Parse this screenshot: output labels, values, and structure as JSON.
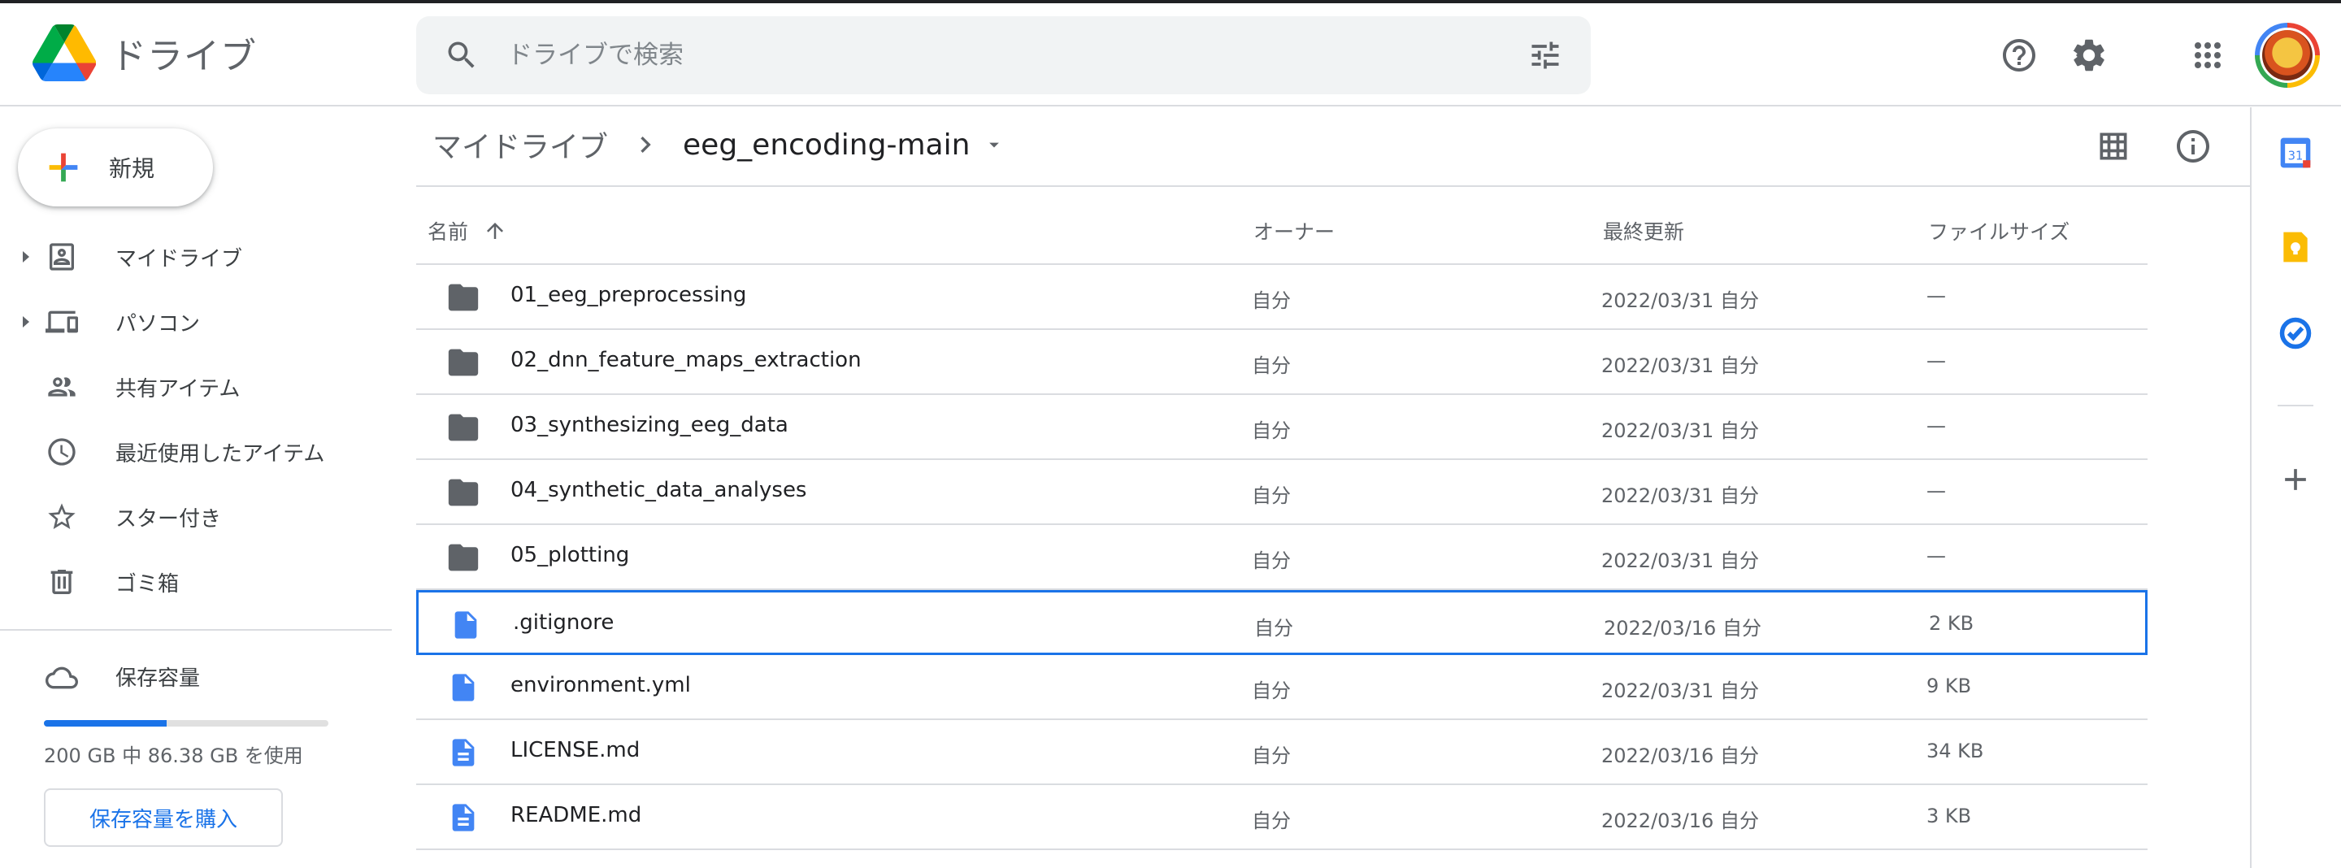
{
  "header": {
    "app_title": "ドライブ",
    "search_placeholder": "ドライブで検索"
  },
  "sidebar": {
    "new_label": "新規",
    "items": [
      {
        "label": "マイドライブ"
      },
      {
        "label": "パソコン"
      },
      {
        "label": "共有アイテム"
      },
      {
        "label": "最近使用したアイテム"
      },
      {
        "label": "スター付き"
      },
      {
        "label": "ゴミ箱"
      }
    ],
    "storage": {
      "title": "保存容量",
      "usage_text": "200 GB 中 86.38 GB を使用",
      "used_fraction": 0.43,
      "buy_label": "保存容量を購入"
    }
  },
  "breadcrumb": {
    "root": "マイドライブ",
    "current": "eeg_encoding-main"
  },
  "table": {
    "headers": {
      "name": "名前",
      "owner": "オーナー",
      "modified": "最終更新",
      "size": "ファイルサイズ"
    },
    "rows": [
      {
        "name": "01_eeg_preprocessing",
        "type": "folder",
        "owner": "自分",
        "modified": "2022/03/31 自分",
        "size": "—"
      },
      {
        "name": "02_dnn_feature_maps_extraction",
        "type": "folder",
        "owner": "自分",
        "modified": "2022/03/31 自分",
        "size": "—"
      },
      {
        "name": "03_synthesizing_eeg_data",
        "type": "folder",
        "owner": "自分",
        "modified": "2022/03/31 自分",
        "size": "—"
      },
      {
        "name": "04_synthetic_data_analyses",
        "type": "folder",
        "owner": "自分",
        "modified": "2022/03/31 自分",
        "size": "—"
      },
      {
        "name": "05_plotting",
        "type": "folder",
        "owner": "自分",
        "modified": "2022/03/31 自分",
        "size": "—"
      },
      {
        "name": ".gitignore",
        "type": "file",
        "owner": "自分",
        "modified": "2022/03/16 自分",
        "size": "2 KB"
      },
      {
        "name": "environment.yml",
        "type": "file",
        "owner": "自分",
        "modified": "2022/03/31 自分",
        "size": "9 KB"
      },
      {
        "name": "LICENSE.md",
        "type": "doc",
        "owner": "自分",
        "modified": "2022/03/16 自分",
        "size": "34 KB"
      },
      {
        "name": "README.md",
        "type": "doc",
        "owner": "自分",
        "modified": "2022/03/16 自分",
        "size": "3 KB"
      }
    ]
  },
  "icons": {
    "folder": "folder-icon",
    "file": "file-icon",
    "doc": "document-icon"
  },
  "colors": {
    "accent": "#1a73e8",
    "folder": "#5f6368",
    "file": "#4285f4",
    "divider": "#dadce0"
  }
}
